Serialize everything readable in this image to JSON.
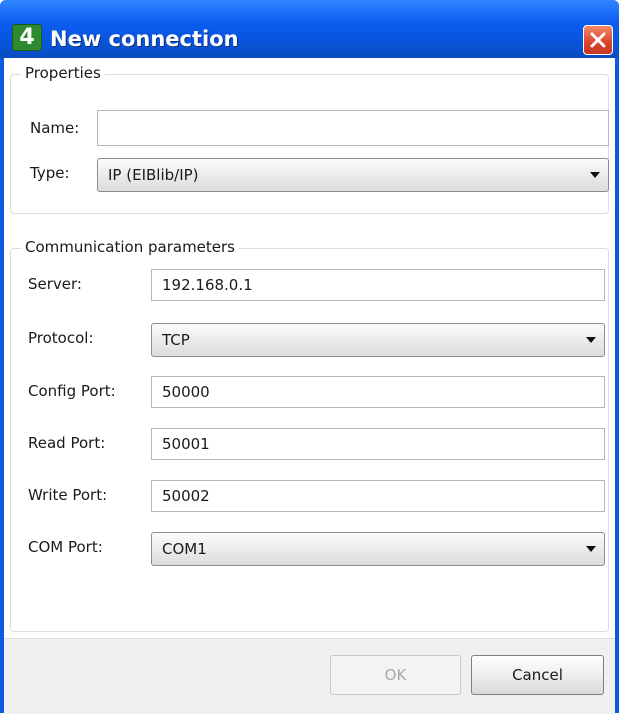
{
  "window": {
    "title": "New connection",
    "icon_name": "app-logo-icon",
    "app_icon_glyph": "4"
  },
  "properties": {
    "group_title": "Properties",
    "name_label": "Name:",
    "name_value": "",
    "type_label": "Type:",
    "type_value": "IP (EIBlib/IP)"
  },
  "communication": {
    "group_title": "Communication parameters",
    "server_label": "Server:",
    "server_value": "192.168.0.1",
    "protocol_label": "Protocol:",
    "protocol_value": "TCP",
    "config_port_label": "Config Port:",
    "config_port_value": "50000",
    "read_port_label": "Read Port:",
    "read_port_value": "50001",
    "write_port_label": "Write Port:",
    "write_port_value": "50002",
    "com_port_label": "COM Port:",
    "com_port_value": "COM1"
  },
  "buttons": {
    "ok_label": "OK",
    "ok_enabled": false,
    "cancel_label": "Cancel"
  },
  "colors": {
    "titlebar": "#0b5cf0",
    "close_button": "#d9442a",
    "app_icon": "#2e8a2e"
  }
}
